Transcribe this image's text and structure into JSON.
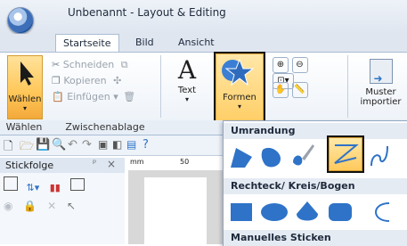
{
  "window": {
    "title": "Unbenannt - Layout & Editing"
  },
  "tabs": [
    {
      "label": "Startseite",
      "active": true
    },
    {
      "label": "Bild",
      "active": false
    },
    {
      "label": "Ansicht",
      "active": false
    }
  ],
  "ribbon": {
    "select": {
      "label": "Wählen"
    },
    "clipboard": {
      "cut": "Schneiden",
      "copy": "Kopieren",
      "paste": "Einfügen",
      "paste_arrow": "▾"
    },
    "text": {
      "label": "Text"
    },
    "shapes": {
      "label": "Formen"
    },
    "import": {
      "line1": "Muster",
      "line2": "importier"
    },
    "group_labels": {
      "select": "Wählen",
      "clipboard": "Zwischenablage"
    }
  },
  "panel": {
    "title": "Stickfolge",
    "pin": "ᵖ",
    "close": "×"
  },
  "ruler": {
    "unit": "mm",
    "mark": "50"
  },
  "dropdown": {
    "section1": "Umrandung",
    "section2": "Rechteck/ Kreis/Bogen",
    "section3": "Manuelles Sticken"
  },
  "colors": {
    "accent_blue": "#2e73c8",
    "highlight_orange": "#f5b53f",
    "ribbon_border": "#a9bcd4"
  }
}
